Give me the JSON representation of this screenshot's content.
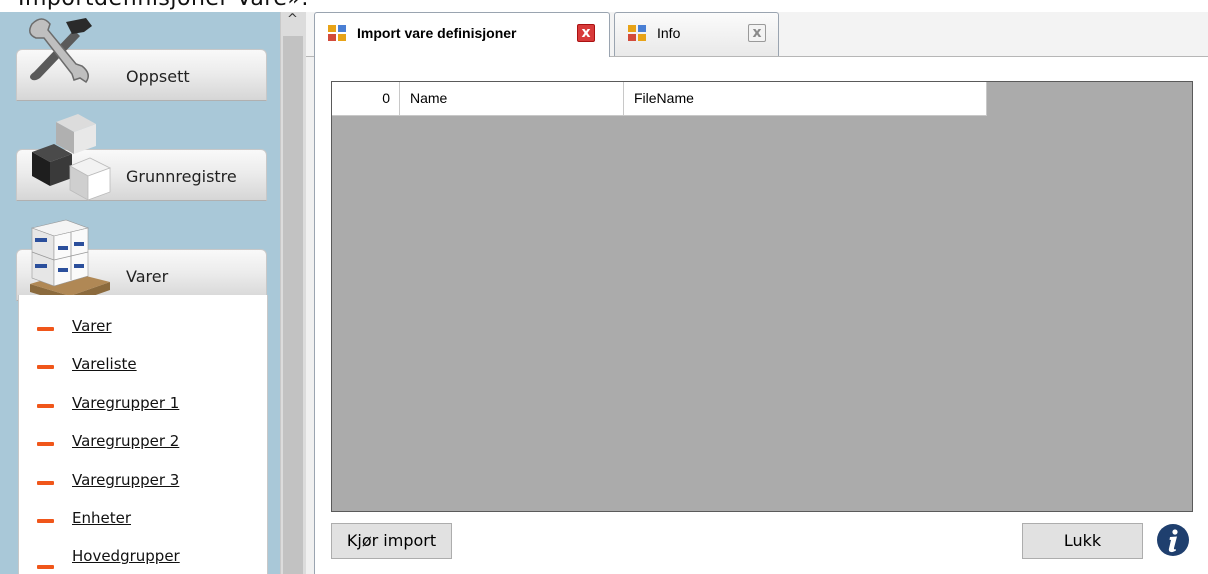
{
  "window_title": "Importdefinisjoner Vare».",
  "sidebar": {
    "sections": [
      {
        "label": "Oppsett",
        "icon": "tools-icon"
      },
      {
        "label": "Grunnregistre",
        "icon": "cubes-icon"
      },
      {
        "label": "Varer",
        "icon": "pallet-boxes-icon"
      }
    ],
    "items": [
      {
        "label": "Varer"
      },
      {
        "label": "Vareliste"
      },
      {
        "label": "Varegrupper 1"
      },
      {
        "label": "Varegrupper 2"
      },
      {
        "label": "Varegrupper 3"
      },
      {
        "label": "Enheter"
      },
      {
        "label": "Hovedgrupper"
      }
    ],
    "accent_color": "#f0561a"
  },
  "tabs": [
    {
      "label": "Import vare definisjoner",
      "active": true,
      "close": "x"
    },
    {
      "label": "Info",
      "active": false,
      "close": "x"
    }
  ],
  "grid": {
    "row_count": "0",
    "columns": [
      "Name",
      "FileName"
    ]
  },
  "buttons": {
    "run_import": "Kjør import",
    "close": "Lukk"
  }
}
